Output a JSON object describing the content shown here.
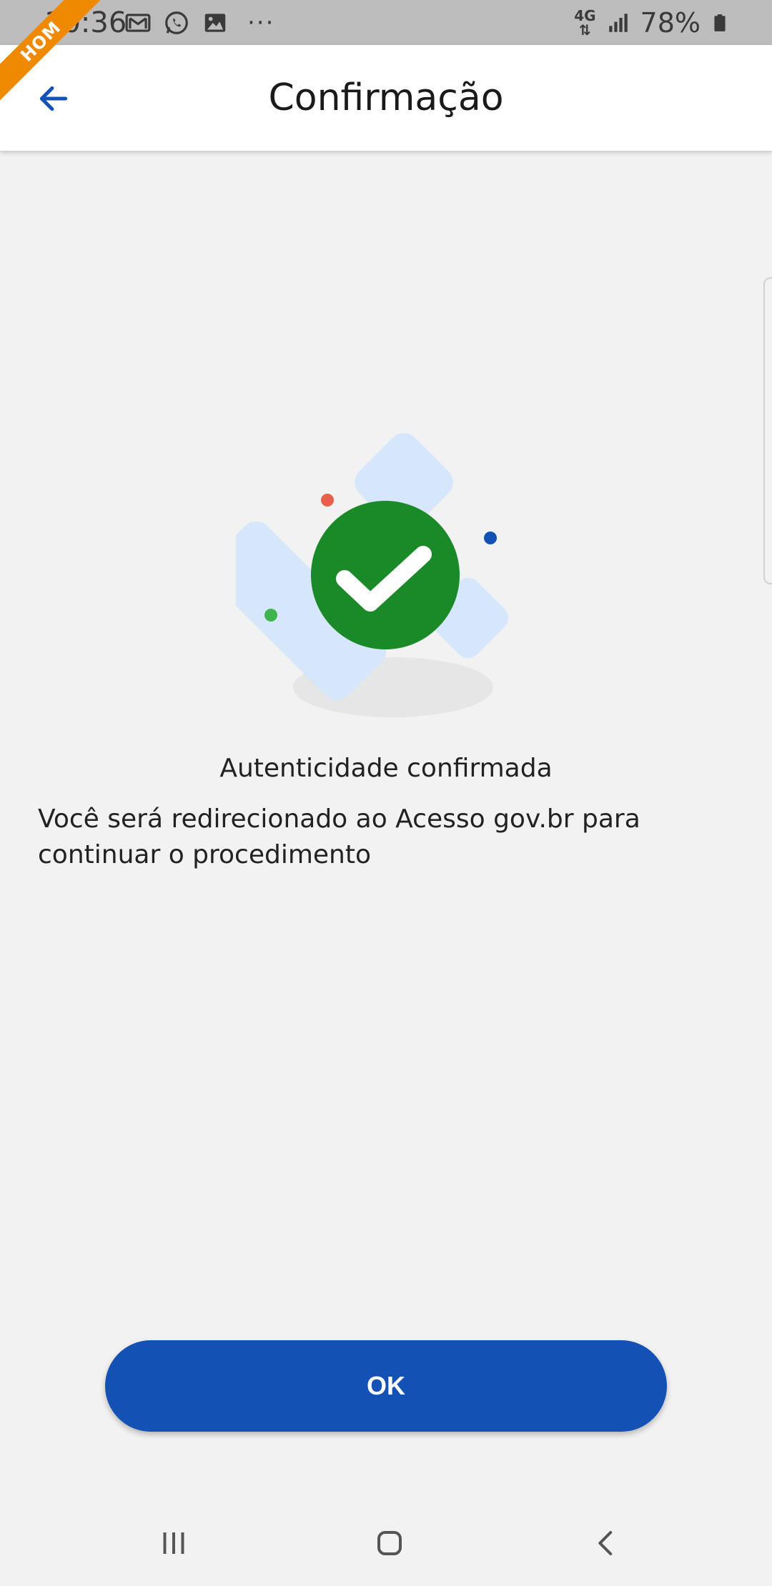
{
  "status_bar": {
    "time": "10:36",
    "left_icons": [
      "gmail-icon",
      "whatsapp-icon",
      "gallery-icon"
    ],
    "more": "···",
    "network_label": "4G",
    "battery_percent": "78%"
  },
  "ribbon": {
    "label": "HOM",
    "color": "#ef8a00"
  },
  "app_bar": {
    "title": "Confirmação",
    "back_icon": "arrow-left-icon"
  },
  "content": {
    "illustration_icon": "check-circle-icon",
    "heading": "Autenticidade confirmada",
    "message": "Você será redirecionado ao Acesso gov.br para continuar o procedimento"
  },
  "ok_button": {
    "label": "OK",
    "color": "#1351b4"
  },
  "nav_bar": {
    "items": [
      "recent-apps-icon",
      "home-icon",
      "back-icon"
    ]
  },
  "colors": {
    "success_green": "#1a8a28",
    "accent_blue": "#1351b4",
    "background": "#f2f2f2"
  }
}
